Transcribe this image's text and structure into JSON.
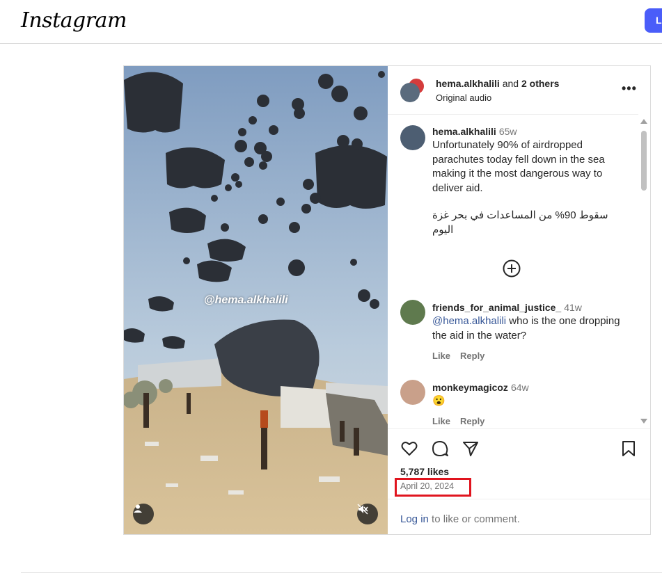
{
  "app": {
    "logo": "Instagram",
    "login_button": "L"
  },
  "post": {
    "watermark": "@hema.alkhalili",
    "header": {
      "author": "hema.alkhalili",
      "connector": "and",
      "others": "2 others",
      "audio": "Original audio"
    },
    "caption": {
      "user": "hema.alkhalili",
      "time": "65w",
      "text_en": "Unfortunately 90% of airdropped parachutes today fell down in the sea making it the most dangerous way to deliver aid.",
      "text_ar": "سقوط 90% من المساعدات في بحر غزة اليوم"
    },
    "comments": [
      {
        "user": "friends_for_animal_justice_",
        "time": "41w",
        "mention": "@hema.alkhalili",
        "text": " who is the one dropping the aid in the water?",
        "like": "Like",
        "reply": "Reply"
      },
      {
        "user": "monkeymagicoz",
        "time": "64w",
        "text": "😮",
        "like": "Like",
        "reply": "Reply"
      }
    ],
    "likes": "5,787 likes",
    "date": "April 20, 2024",
    "login_prompt": {
      "link": "Log in",
      "rest": " to like or comment."
    }
  },
  "colors": {
    "accent": "#4a5df9",
    "highlight_box": "#e0141e",
    "link": "#385898"
  }
}
